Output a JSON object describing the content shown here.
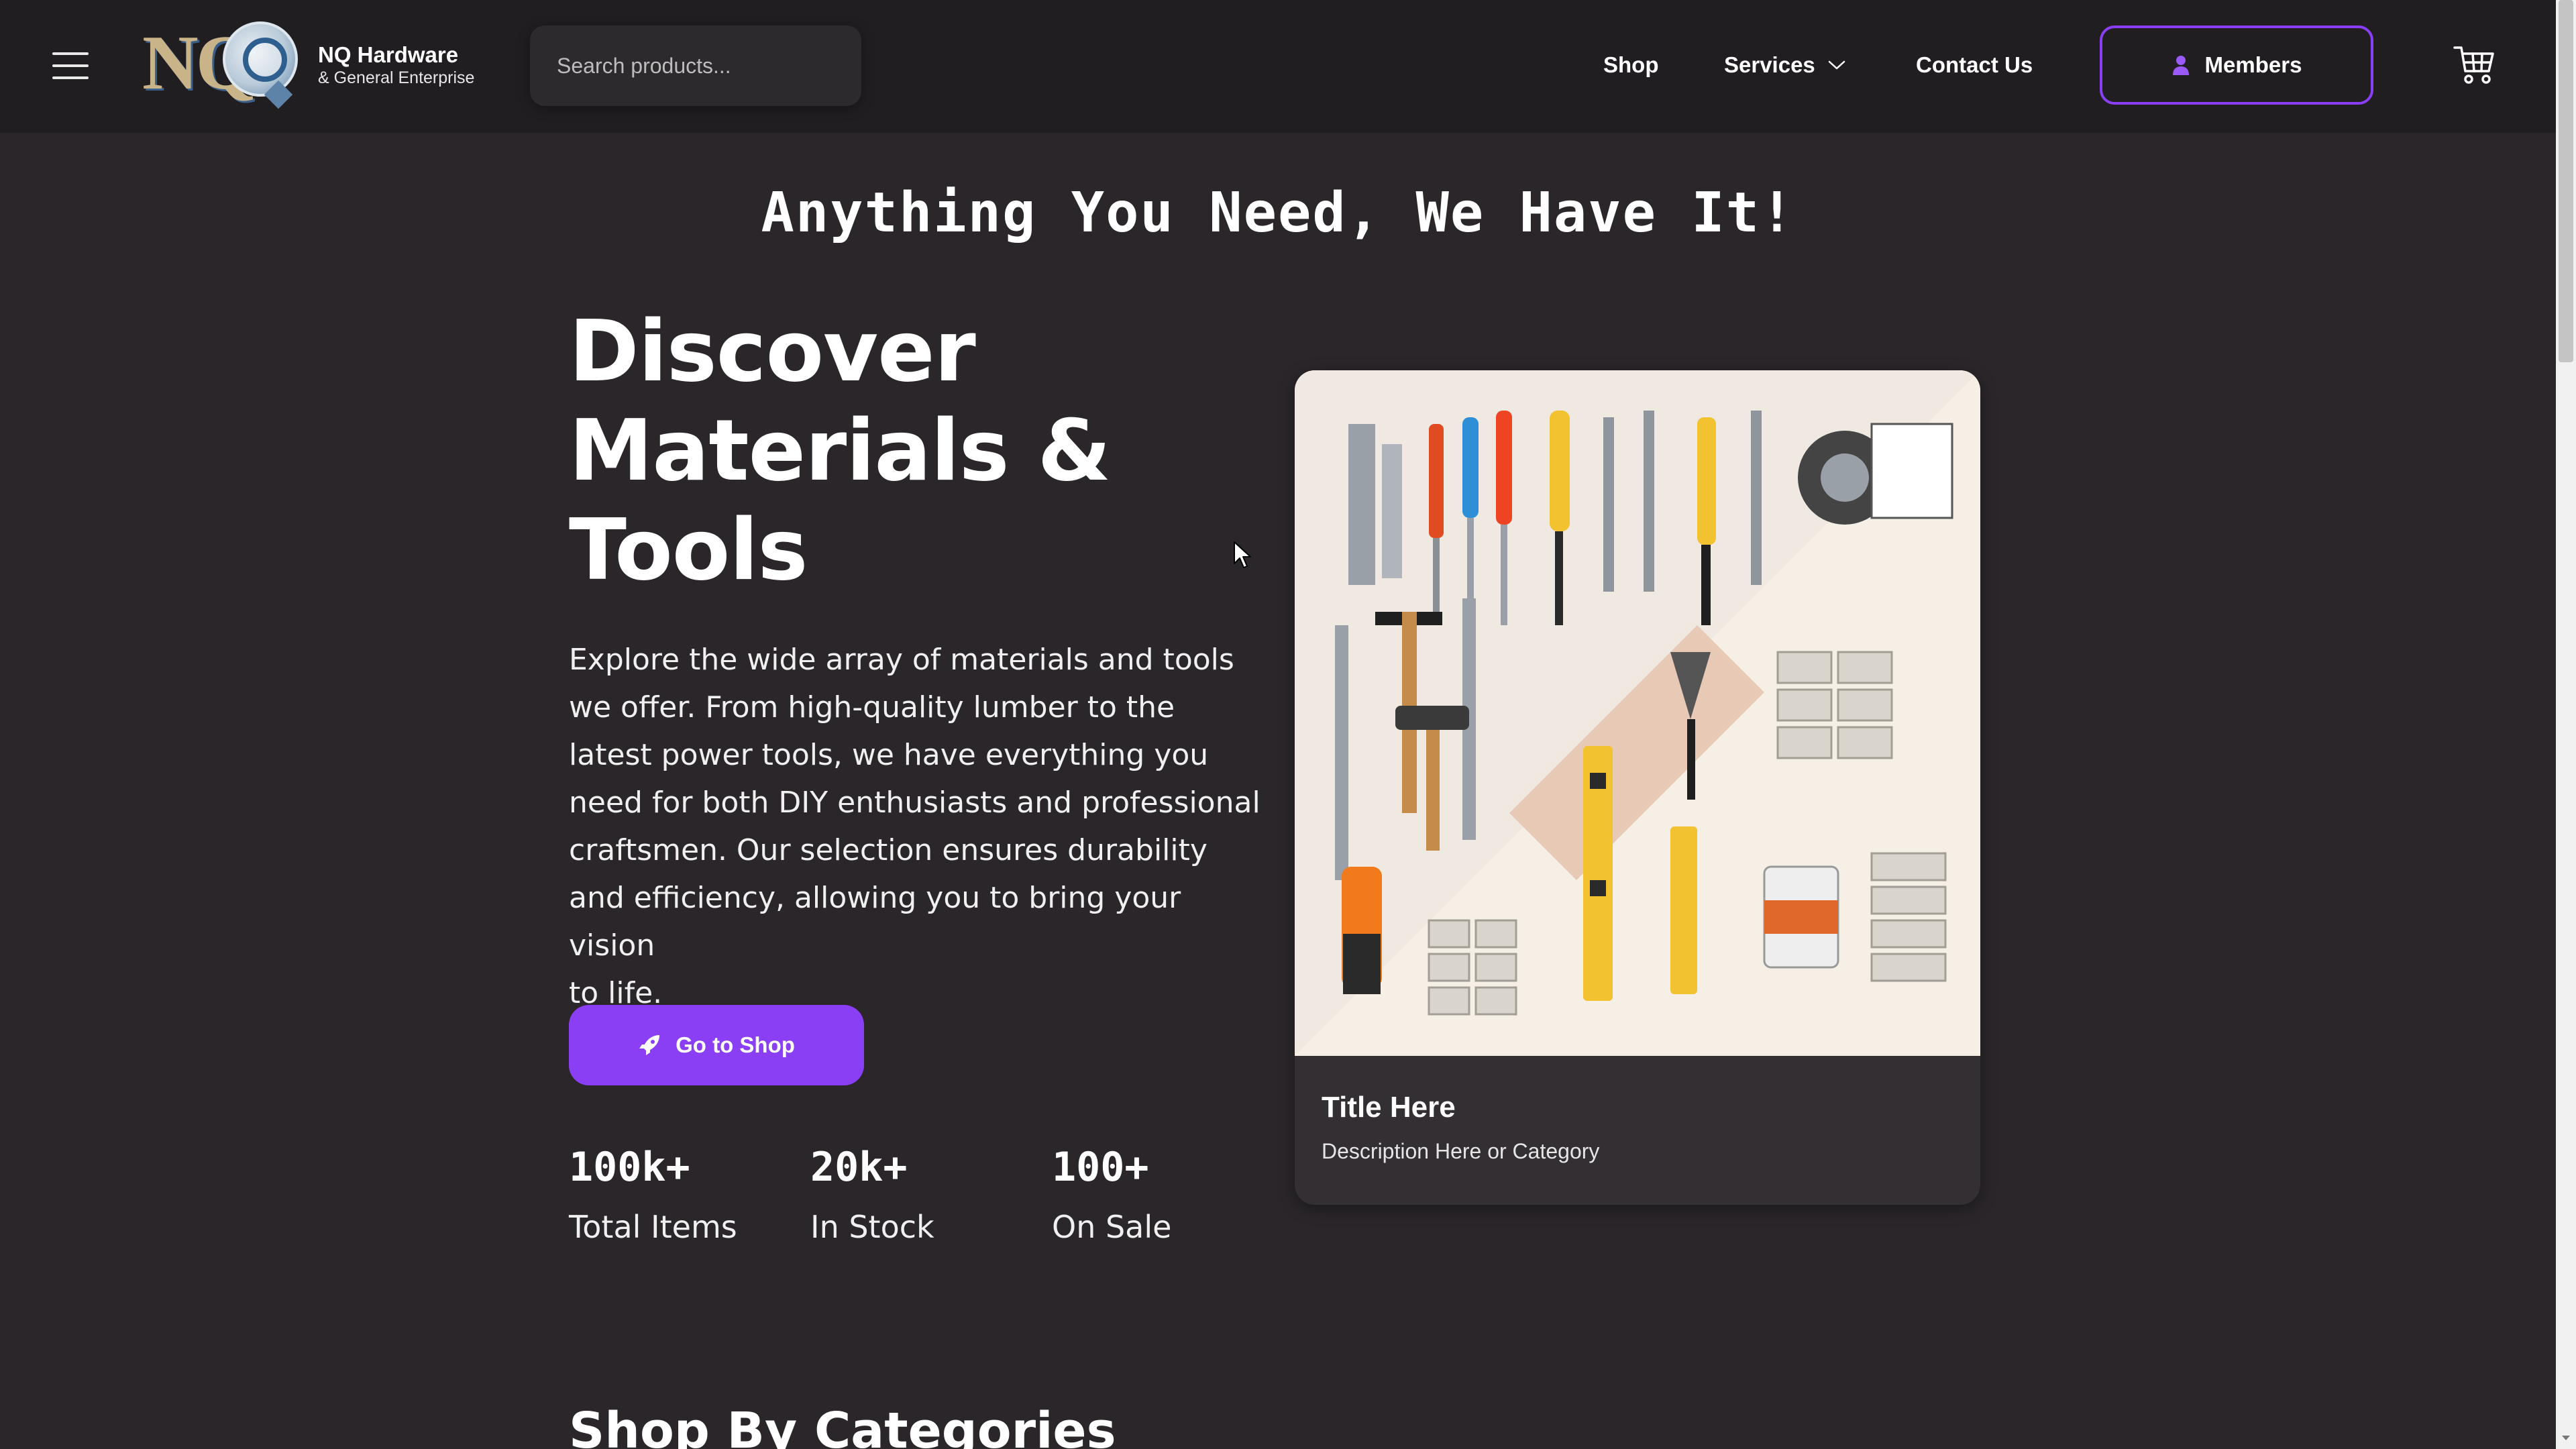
{
  "header": {
    "brand_name": "NQ Hardware",
    "brand_sub": "& General Enterprise",
    "logo_letters": "NQ",
    "search_placeholder": "Search products...",
    "nav": {
      "shop": "Shop",
      "services": "Services",
      "contact": "Contact Us"
    },
    "members_label": "Members"
  },
  "hero": {
    "tagline": "Anything You Need, We Have It!",
    "title_lines": [
      "Discover",
      "Materials &",
      "Tools"
    ],
    "description_lines": [
      "Explore the wide array of materials and tools",
      "we offer. From high-quality lumber to the",
      "latest power tools, we have everything you",
      "need for both DIY enthusiasts and professional",
      "craftsmen. Our selection ensures durability",
      "and efficiency, allowing you to bring your vision",
      "to life."
    ],
    "cta_label": "Go to Shop",
    "stats": [
      {
        "value": "100k+",
        "label": "Total Items"
      },
      {
        "value": "20k+",
        "label": "In Stock"
      },
      {
        "value": "100+",
        "label": "On Sale"
      }
    ]
  },
  "card": {
    "title": "Title Here",
    "description": "Description Here or Category"
  },
  "sections": {
    "categories_title": "Shop By Categories"
  },
  "colors": {
    "background": "#2a2629",
    "header_bg": "#211e21",
    "accent": "#8b3ff5",
    "card_bg": "#332f33"
  },
  "icons": {
    "menu": "hamburger-icon",
    "search": "search-icon",
    "dropdown": "chevron-down-icon",
    "member": "person-icon",
    "cart": "cart-icon",
    "cta": "rocket-icon"
  }
}
